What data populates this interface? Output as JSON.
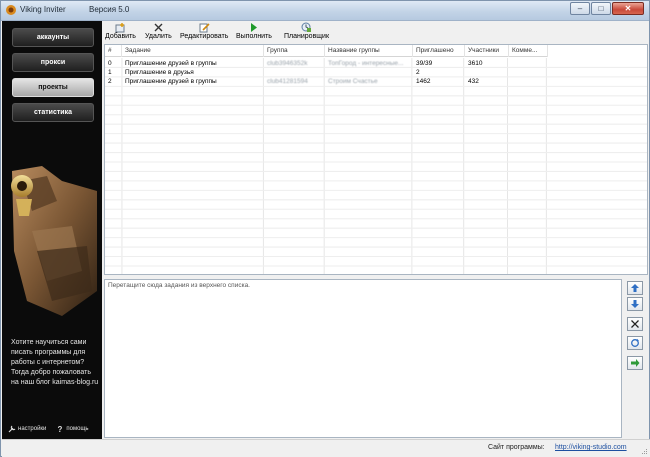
{
  "window": {
    "title": "Viking Inviter",
    "version": "Версия 5.0"
  },
  "sidebar": {
    "nav": [
      {
        "label": "аккаунты",
        "active": false
      },
      {
        "label": "прокси",
        "active": false
      },
      {
        "label": "проекты",
        "active": true
      },
      {
        "label": "статистика",
        "active": false
      }
    ],
    "promo": "Хотите научиться сами писать программы для работы с интернетом? Тогда добро пожаловать на наш блог kaimas-blog.ru",
    "footer": {
      "settings_label": "настройки",
      "help_label": "помощь"
    }
  },
  "toolbar": {
    "buttons": [
      {
        "label": "Добавить",
        "icon": "add-task-icon"
      },
      {
        "label": "Удалить",
        "icon": "close-icon"
      },
      {
        "label": "Редактировать",
        "icon": "edit-icon"
      },
      {
        "label": "Выполнить",
        "icon": "play-icon"
      },
      {
        "label": "Планировщик",
        "icon": "scheduler-icon"
      }
    ]
  },
  "table": {
    "columns": [
      "#",
      "Задание",
      "Группа",
      "Название группы",
      "Приглашено",
      "Участники",
      "Комме..."
    ],
    "rows": [
      [
        "0",
        "Приглашение друзей в группы",
        "club3946352k",
        "ТопГород - интересные...",
        "39/39",
        "3610",
        ""
      ],
      [
        "1",
        "Приглашение в друзья",
        "",
        "",
        "2",
        "",
        ""
      ],
      [
        "2",
        "Приглашение друзей в группы",
        "club41281594",
        "Строим Счастье",
        "1462",
        "432",
        ""
      ]
    ]
  },
  "log": {
    "text": "Перетащите сюда задания из верхнего списка."
  },
  "side_tools": [
    "arrow-up-icon",
    "arrow-down-icon",
    "clear-icon",
    "refresh-icon",
    "forward-icon"
  ],
  "status": {
    "label": "Сайт программы:",
    "link": "http://viking-studio.com"
  },
  "colors": {
    "sidebar_bg": "#0b0b0b",
    "active_nav": "#c8c8c8",
    "link": "#1d4fa0"
  }
}
